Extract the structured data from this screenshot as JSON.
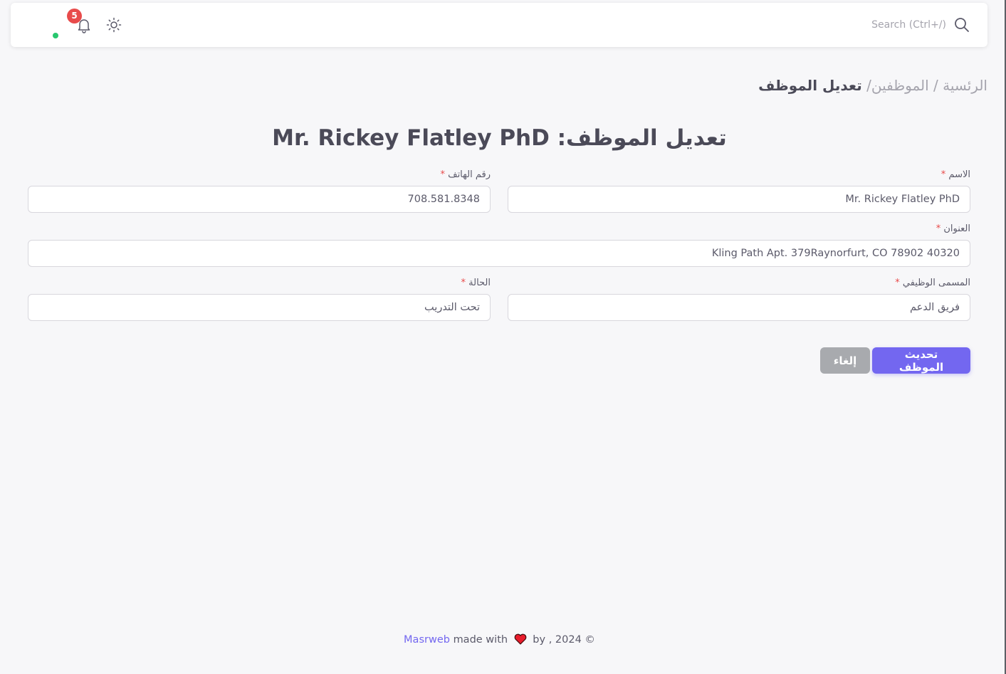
{
  "header": {
    "search_placeholder": "Search (Ctrl+/)",
    "notification_count": "5",
    "icons": [
      "search-icon",
      "sun-icon",
      "bell-icon"
    ]
  },
  "breadcrumb": {
    "home": "الرئسية",
    "separator1": " / ",
    "employees": "الموظفين",
    "separator2": "/ ",
    "current": "تعديل الموظف"
  },
  "page": {
    "title": "تعديل الموظف: Mr. Rickey Flatley PhD"
  },
  "form": {
    "required_mark": "*",
    "name": {
      "label": "الاسم",
      "value": "Mr. Rickey Flatley PhD"
    },
    "phone": {
      "label": "رقم الهاتف",
      "value": "708.581.8348"
    },
    "address": {
      "label": "العنوان",
      "value": "Kling Path Apt. 379Raynorfurt, CO 78902 40320"
    },
    "job_title": {
      "label": "المسمى الوظيفي",
      "value": "فريق الدعم"
    },
    "status": {
      "label": "الحالة",
      "value": "تحت التدريب"
    },
    "submit_label": "تحديث الموظف",
    "cancel_label": "إلغاء"
  },
  "footer": {
    "copyright": "© 2024 , by",
    "made_with": "made with",
    "brand": "Masrweb"
  },
  "colors": {
    "primary": "#7367f0",
    "secondary": "#a8aaae",
    "danger": "#e84b4b",
    "success": "#28c76f",
    "background": "#f7f7f9"
  }
}
